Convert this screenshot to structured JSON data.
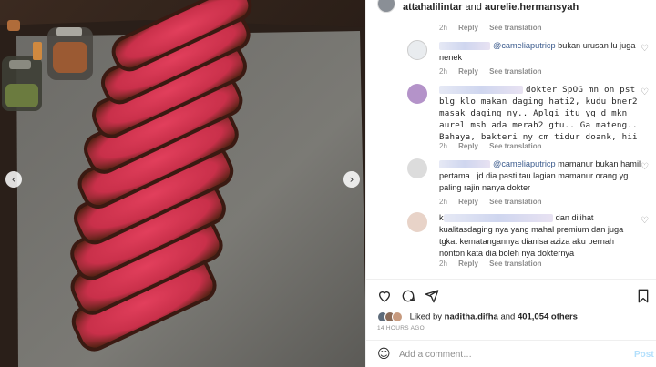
{
  "post": {
    "header_user1": "attahalilintar",
    "header_and": "and",
    "header_user2": "aurelie.hermansyah",
    "top_meta": {
      "time": "2h",
      "reply": "Reply",
      "translation": "See translation"
    }
  },
  "comments": [
    {
      "mention": "@cameliaputricp",
      "text": "bukan urusan lu juga nenek",
      "time": "2h",
      "reply": "Reply",
      "translation": "See translation"
    },
    {
      "text_line1": "dokter SpOG mn",
      "text_rest": "on pst blg klo makan daging hati2, kudu bner2 masak daging ny.. Aplgi itu yg d mkn aurel msh ada merah2 gtu.. Ga mateng.. Bahaya, bakteri ny cm tidur doank, hii",
      "time": "2h",
      "reply": "Reply",
      "translation": "See translation"
    },
    {
      "mention": "@cameliaputricp",
      "text": "mamanur bukan hamil pertama...jd dia pasti tau lagian mamanur orang yg paling rajin nanya dokter",
      "time": "2h",
      "reply": "Reply",
      "translation": "See translation"
    },
    {
      "prefix": "k",
      "text_line1": "dan dilihat",
      "text_rest": "kualitasdaging nya yang mahal premium dan juga tgkat kematangannya dianisa aziza aku pernah nonton kata dia boleh nya dokternya",
      "time": "2h",
      "reply": "Reply",
      "translation": "See translation"
    }
  ],
  "likes": {
    "liked_by": "Liked by",
    "user": "naditha.difha",
    "and": "and",
    "count": "401,054 others"
  },
  "time_ago": "14 HOURS AGO",
  "add_comment": {
    "placeholder": "Add a comment…",
    "post_label": "Post"
  },
  "icons": {
    "like": "heart-icon",
    "comment": "comment-icon",
    "share": "share-icon",
    "save": "bookmark-icon",
    "emoji": "emoji-icon",
    "prev": "chevron-left-icon",
    "next": "chevron-right-icon"
  }
}
